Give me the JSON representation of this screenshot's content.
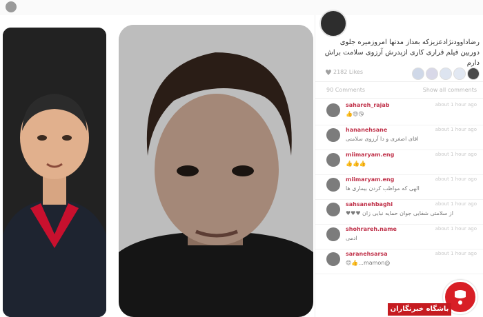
{
  "post": {
    "caption": "رضاداوودنژادعزیزکه بعداز مدتها امروزمیره جلوی دوربین فیلم قراری کاری ازپدرش آرزوی سلامت براش دارم",
    "likes_count": "2182 Likes",
    "comments_count": "90 Comments",
    "show_all": "Show all comments"
  },
  "comments": [
    {
      "user": "sahareh_rajab",
      "time": "about 1 hour ago",
      "text": "😘😍👍"
    },
    {
      "user": "hananehsane",
      "time": "about 1 hour ago",
      "text": "اقای اصغری و دا آرزوی سلامتی"
    },
    {
      "user": "miimaryam.eng",
      "time": "about 1 hour ago",
      "text": "👍👍👍"
    },
    {
      "user": "miimaryam.eng",
      "time": "about 1 hour ago",
      "text": "الهی که مواظب کردن بیماری ها"
    },
    {
      "user": "sahsanehbaghi",
      "time": "about 1 hour ago",
      "text": "از سلامتی شفایی جوان حمایه نبایی زان ♥♥♥"
    },
    {
      "user": "shohrareh.name",
      "time": "about 1 hour ago",
      "text": "ادمی"
    },
    {
      "user": "saranehsarsa",
      "time": "about 1 hour ago",
      "text": "@mamon...👍😊"
    }
  ],
  "badge": {
    "label": "باشگاه خبرنگاران"
  },
  "colors": {
    "username": "#c0324a",
    "badge": "#d81f26"
  }
}
